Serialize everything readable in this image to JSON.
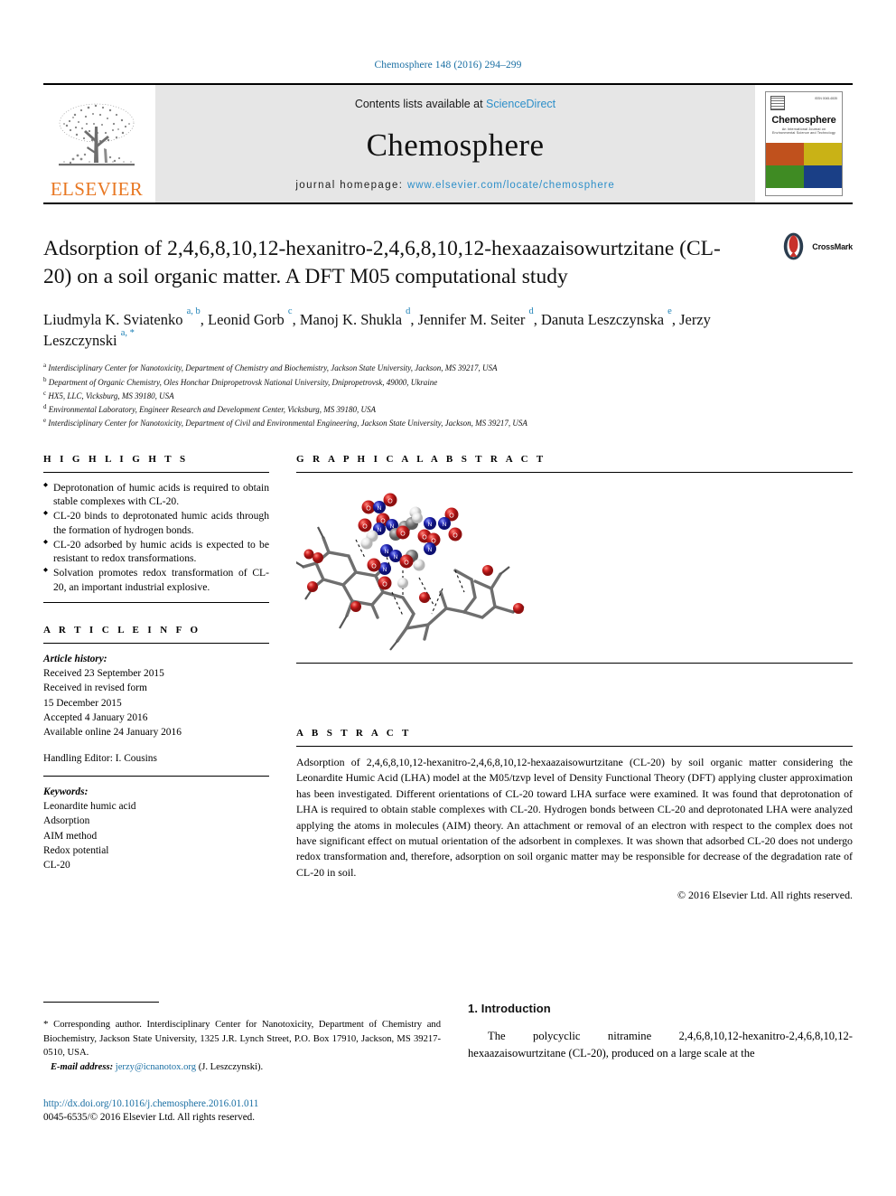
{
  "running_head": "Chemosphere 148 (2016) 294–299",
  "masthead": {
    "publisher": "ELSEVIER",
    "contents_prefix": "Contents lists available at ",
    "contents_link": "ScienceDirect",
    "journal_title": "Chemosphere",
    "homepage_label": "journal homepage:",
    "homepage_url": "www.elsevier.com/locate/chemosphere",
    "cover": {
      "name": "Chemosphere",
      "subtitle": "An International Journal on Environmental Science and Technology",
      "issn": "ISSN 0045-6535"
    }
  },
  "article": {
    "title": "Adsorption of 2,4,6,8,10,12-hexanitro-2,4,6,8,10,12-hexaazaisowurtzitane (CL-20) on a soil organic matter. A DFT M05 computational study",
    "crossmark_label": "CrossMark",
    "authors": [
      {
        "name": "Liudmyla K. Sviatenko",
        "marks": "a, b",
        "sep": ", "
      },
      {
        "name": "Leonid Gorb",
        "marks": "c",
        "sep": ", "
      },
      {
        "name": "Manoj K. Shukla",
        "marks": "d",
        "sep": ", "
      },
      {
        "name": "Jennifer M. Seiter",
        "marks": "d",
        "sep": ", "
      },
      {
        "name": "Danuta Leszczynska",
        "marks": "e",
        "sep": ", "
      },
      {
        "name": "Jerzy Leszczynski",
        "marks": "a, *",
        "sep": ""
      }
    ],
    "affiliations": [
      {
        "mark": "a",
        "text": "Interdisciplinary Center for Nanotoxicity, Department of Chemistry and Biochemistry, Jackson State University, Jackson, MS 39217, USA"
      },
      {
        "mark": "b",
        "text": "Department of Organic Chemistry, Oles Honchar Dnipropetrovsk National University, Dnipropetrovsk, 49000, Ukraine"
      },
      {
        "mark": "c",
        "text": "HX5, LLC, Vicksburg, MS 39180, USA"
      },
      {
        "mark": "d",
        "text": "Environmental Laboratory, Engineer Research and Development Center, Vicksburg, MS 39180, USA"
      },
      {
        "mark": "e",
        "text": "Interdisciplinary Center for Nanotoxicity, Department of Civil and Environmental Engineering, Jackson State University, Jackson, MS 39217, USA"
      }
    ]
  },
  "highlights": {
    "heading": "H I G H L I G H T S",
    "items": [
      "Deprotonation of humic acids is required to obtain stable complexes with CL-20.",
      "CL-20 binds to deprotonated humic acids through the formation of hydrogen bonds.",
      "CL-20 adsorbed by humic acids is expected to be resistant to redox transformations.",
      "Solvation promotes redox transformation of CL-20, an important industrial explosive."
    ]
  },
  "graphical_abstract": {
    "heading": "G R A P H I C A L  A B S T R A C T",
    "image_alt": "Ball-and-stick model of CL-20 adsorbed on deprotonated Leonardite Humic Acid showing hydrogen bonds as dashed lines"
  },
  "article_info": {
    "heading": "A R T I C L E  I N F O",
    "history_label": "Article history:",
    "history": [
      "Received 23 September 2015",
      "Received in revised form",
      "15 December 2015",
      "Accepted 4 January 2016",
      "Available online 24 January 2016"
    ],
    "handling_editor": "Handling Editor: I. Cousins",
    "keywords_label": "Keywords:",
    "keywords": [
      "Leonardite humic acid",
      "Adsorption",
      "AIM method",
      "Redox potential",
      "CL-20"
    ]
  },
  "abstract": {
    "heading": "A B S T R A C T",
    "text": "Adsorption of 2,4,6,8,10,12-hexanitro-2,4,6,8,10,12-hexaazaisowurtzitane (CL-20) by soil organic matter considering the Leonardite Humic Acid (LHA) model at the M05/tzvp level of Density Functional Theory (DFT) applying cluster approximation has been investigated. Different orientations of CL-20 toward LHA surface were examined. It was found that deprotonation of LHA is required to obtain stable complexes with CL-20. Hydrogen bonds between CL-20 and deprotonated LHA were analyzed applying the atoms in molecules (AIM) theory. An attachment or removal of an electron with respect to the complex does not have significant effect on mutual orientation of the adsorbent in complexes. It was shown that adsorbed CL-20 does not undergo redox transformation and, therefore, adsorption on soil organic matter may be responsible for decrease of the degradation rate of CL-20 in soil.",
    "copyright": "© 2016 Elsevier Ltd. All rights reserved."
  },
  "footer": {
    "corresponding_star": "*",
    "corresponding_text": "Corresponding author. Interdisciplinary Center for Nanotoxicity, Department of Chemistry and Biochemistry, Jackson State University, 1325 J.R. Lynch Street, P.O. Box 17910, Jackson, MS 39217-0510, USA.",
    "email_label": "E-mail address:",
    "email": "jerzy@icnanotox.org",
    "email_owner": "(J. Leszczynski).",
    "doi": "http://dx.doi.org/10.1016/j.chemosphere.2016.01.011",
    "issn_copyright": "0045-6535/© 2016 Elsevier Ltd. All rights reserved."
  },
  "introduction": {
    "number_title": "1. Introduction",
    "paragraph": "The polycyclic nitramine 2,4,6,8,10,12-hexanitro-2,4,6,8,10,12-hexaazaisowurtzitane (CL-20), produced on a large scale at the"
  }
}
